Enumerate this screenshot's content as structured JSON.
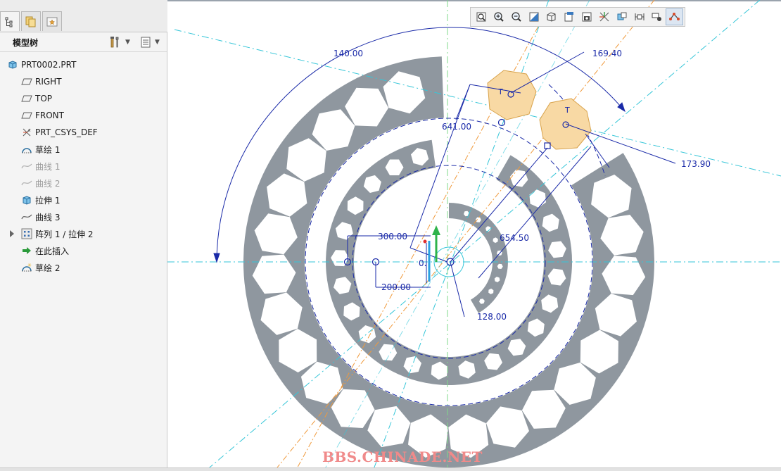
{
  "panel": {
    "title": "模型树",
    "tabs": [
      {
        "name": "model-tree-tab-icon"
      },
      {
        "name": "folder-browser-tab-icon"
      },
      {
        "name": "favorites-tab-icon"
      }
    ],
    "tree": [
      {
        "label": "PRT0002.PRT",
        "icon": "part-icon",
        "level": 0,
        "disabled": false
      },
      {
        "label": "RIGHT",
        "icon": "datum-plane-icon",
        "level": 1,
        "disabled": false
      },
      {
        "label": "TOP",
        "icon": "datum-plane-icon",
        "level": 1,
        "disabled": false
      },
      {
        "label": "FRONT",
        "icon": "datum-plane-icon",
        "level": 1,
        "disabled": false
      },
      {
        "label": "PRT_CSYS_DEF",
        "icon": "csys-icon",
        "level": 1,
        "disabled": false
      },
      {
        "label": "草绘 1",
        "icon": "sketch-icon",
        "level": 1,
        "disabled": false
      },
      {
        "label": "曲线 1",
        "icon": "curve-icon",
        "level": 1,
        "disabled": true
      },
      {
        "label": "曲线 2",
        "icon": "curve-icon",
        "level": 1,
        "disabled": true
      },
      {
        "label": "拉伸 1",
        "icon": "extrude-icon",
        "level": 1,
        "disabled": false
      },
      {
        "label": "曲线 3",
        "icon": "curve-icon",
        "level": 1,
        "disabled": false
      },
      {
        "label": "阵列 1 / 拉伸 2",
        "icon": "pattern-icon",
        "level": 1,
        "disabled": false,
        "expandable": true
      },
      {
        "label": "在此插入",
        "icon": "insert-here-icon",
        "level": 1,
        "disabled": false
      },
      {
        "label": "草绘 2",
        "icon": "sketch-new-icon",
        "level": 1,
        "disabled": false
      }
    ]
  },
  "toolbar": {
    "buttons": [
      {
        "name": "refit-icon"
      },
      {
        "name": "zoom-in-icon"
      },
      {
        "name": "zoom-out-icon"
      },
      {
        "name": "repaint-icon"
      },
      {
        "name": "display-style-icon"
      },
      {
        "name": "saved-views-icon"
      },
      {
        "name": "view-manager-icon"
      },
      {
        "name": "datum-display-icon"
      },
      {
        "name": "annotation-display-icon"
      },
      {
        "name": "dimension-display-icon"
      },
      {
        "name": "constraint-display-icon"
      },
      {
        "name": "vertex-display-icon"
      }
    ]
  },
  "drawing": {
    "dimensions": [
      {
        "id": "dim-140",
        "text": "140.00"
      },
      {
        "id": "dim-169",
        "text": "169.40"
      },
      {
        "id": "dim-641",
        "text": "641.00"
      },
      {
        "id": "dim-173",
        "text": "173.90"
      },
      {
        "id": "dim-300",
        "text": "300.00"
      },
      {
        "id": "dim-654",
        "text": "654.50"
      },
      {
        "id": "dim-200",
        "text": "200.00"
      },
      {
        "id": "dim-128",
        "text": "128.00"
      },
      {
        "id": "dim-0",
        "text": "0."
      }
    ],
    "constraint_labels": [
      "T",
      "T"
    ],
    "colors": {
      "part": "#8f979f",
      "dimension": "#1a2aa8",
      "centerline": "#36c6d8",
      "orange": "#f09a3c",
      "highlight": "#f8d9a4",
      "axis_green": "#2fb34a"
    }
  },
  "watermark": "BBS.CHINADE.NET"
}
